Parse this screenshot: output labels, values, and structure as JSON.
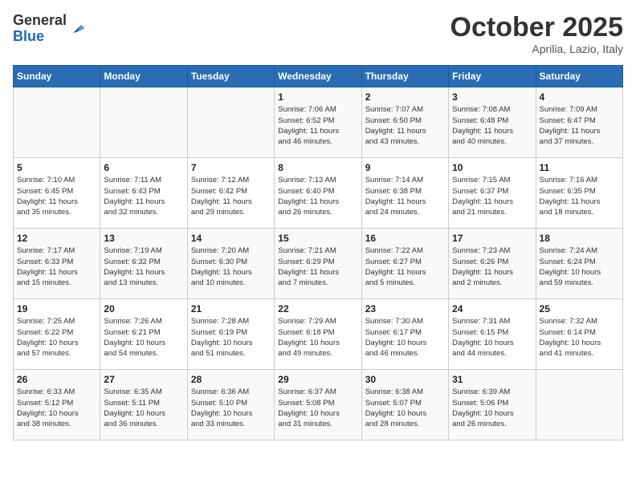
{
  "header": {
    "logo_general": "General",
    "logo_blue": "Blue",
    "month_title": "October 2025",
    "location": "Aprilia, Lazio, Italy"
  },
  "weekdays": [
    "Sunday",
    "Monday",
    "Tuesday",
    "Wednesday",
    "Thursday",
    "Friday",
    "Saturday"
  ],
  "weeks": [
    [
      {
        "day": "",
        "text": ""
      },
      {
        "day": "",
        "text": ""
      },
      {
        "day": "",
        "text": ""
      },
      {
        "day": "1",
        "text": "Sunrise: 7:06 AM\nSunset: 6:52 PM\nDaylight: 11 hours\nand 46 minutes."
      },
      {
        "day": "2",
        "text": "Sunrise: 7:07 AM\nSunset: 6:50 PM\nDaylight: 11 hours\nand 43 minutes."
      },
      {
        "day": "3",
        "text": "Sunrise: 7:08 AM\nSunset: 6:48 PM\nDaylight: 11 hours\nand 40 minutes."
      },
      {
        "day": "4",
        "text": "Sunrise: 7:09 AM\nSunset: 6:47 PM\nDaylight: 11 hours\nand 37 minutes."
      }
    ],
    [
      {
        "day": "5",
        "text": "Sunrise: 7:10 AM\nSunset: 6:45 PM\nDaylight: 11 hours\nand 35 minutes."
      },
      {
        "day": "6",
        "text": "Sunrise: 7:11 AM\nSunset: 6:43 PM\nDaylight: 11 hours\nand 32 minutes."
      },
      {
        "day": "7",
        "text": "Sunrise: 7:12 AM\nSunset: 6:42 PM\nDaylight: 11 hours\nand 29 minutes."
      },
      {
        "day": "8",
        "text": "Sunrise: 7:13 AM\nSunset: 6:40 PM\nDaylight: 11 hours\nand 26 minutes."
      },
      {
        "day": "9",
        "text": "Sunrise: 7:14 AM\nSunset: 6:38 PM\nDaylight: 11 hours\nand 24 minutes."
      },
      {
        "day": "10",
        "text": "Sunrise: 7:15 AM\nSunset: 6:37 PM\nDaylight: 11 hours\nand 21 minutes."
      },
      {
        "day": "11",
        "text": "Sunrise: 7:16 AM\nSunset: 6:35 PM\nDaylight: 11 hours\nand 18 minutes."
      }
    ],
    [
      {
        "day": "12",
        "text": "Sunrise: 7:17 AM\nSunset: 6:33 PM\nDaylight: 11 hours\nand 15 minutes."
      },
      {
        "day": "13",
        "text": "Sunrise: 7:19 AM\nSunset: 6:32 PM\nDaylight: 11 hours\nand 13 minutes."
      },
      {
        "day": "14",
        "text": "Sunrise: 7:20 AM\nSunset: 6:30 PM\nDaylight: 11 hours\nand 10 minutes."
      },
      {
        "day": "15",
        "text": "Sunrise: 7:21 AM\nSunset: 6:29 PM\nDaylight: 11 hours\nand 7 minutes."
      },
      {
        "day": "16",
        "text": "Sunrise: 7:22 AM\nSunset: 6:27 PM\nDaylight: 11 hours\nand 5 minutes."
      },
      {
        "day": "17",
        "text": "Sunrise: 7:23 AM\nSunset: 6:26 PM\nDaylight: 11 hours\nand 2 minutes."
      },
      {
        "day": "18",
        "text": "Sunrise: 7:24 AM\nSunset: 6:24 PM\nDaylight: 10 hours\nand 59 minutes."
      }
    ],
    [
      {
        "day": "19",
        "text": "Sunrise: 7:25 AM\nSunset: 6:22 PM\nDaylight: 10 hours\nand 57 minutes."
      },
      {
        "day": "20",
        "text": "Sunrise: 7:26 AM\nSunset: 6:21 PM\nDaylight: 10 hours\nand 54 minutes."
      },
      {
        "day": "21",
        "text": "Sunrise: 7:28 AM\nSunset: 6:19 PM\nDaylight: 10 hours\nand 51 minutes."
      },
      {
        "day": "22",
        "text": "Sunrise: 7:29 AM\nSunset: 6:18 PM\nDaylight: 10 hours\nand 49 minutes."
      },
      {
        "day": "23",
        "text": "Sunrise: 7:30 AM\nSunset: 6:17 PM\nDaylight: 10 hours\nand 46 minutes."
      },
      {
        "day": "24",
        "text": "Sunrise: 7:31 AM\nSunset: 6:15 PM\nDaylight: 10 hours\nand 44 minutes."
      },
      {
        "day": "25",
        "text": "Sunrise: 7:32 AM\nSunset: 6:14 PM\nDaylight: 10 hours\nand 41 minutes."
      }
    ],
    [
      {
        "day": "26",
        "text": "Sunrise: 6:33 AM\nSunset: 5:12 PM\nDaylight: 10 hours\nand 38 minutes."
      },
      {
        "day": "27",
        "text": "Sunrise: 6:35 AM\nSunset: 5:11 PM\nDaylight: 10 hours\nand 36 minutes."
      },
      {
        "day": "28",
        "text": "Sunrise: 6:36 AM\nSunset: 5:10 PM\nDaylight: 10 hours\nand 33 minutes."
      },
      {
        "day": "29",
        "text": "Sunrise: 6:37 AM\nSunset: 5:08 PM\nDaylight: 10 hours\nand 31 minutes."
      },
      {
        "day": "30",
        "text": "Sunrise: 6:38 AM\nSunset: 5:07 PM\nDaylight: 10 hours\nand 28 minutes."
      },
      {
        "day": "31",
        "text": "Sunrise: 6:39 AM\nSunset: 5:06 PM\nDaylight: 10 hours\nand 26 minutes."
      },
      {
        "day": "",
        "text": ""
      }
    ]
  ]
}
